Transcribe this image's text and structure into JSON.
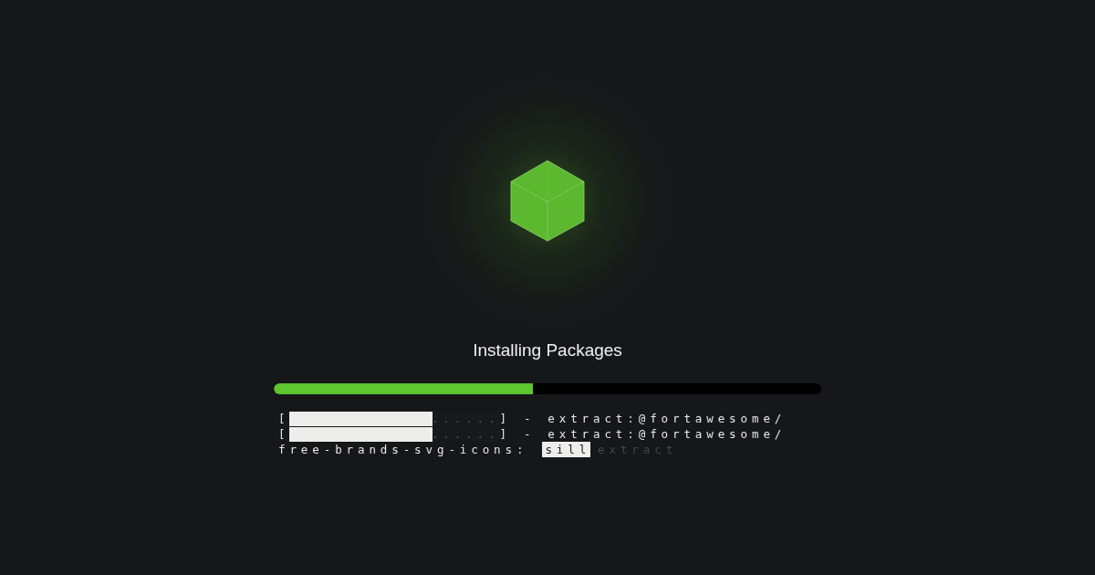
{
  "title": "Installing Packages",
  "progress": {
    "level": 0.473
  },
  "log_lines": [
    {
      "kind": "gauge",
      "open": "[",
      "level": 0.68,
      "dots": "......",
      "close": "]",
      "separator": "-",
      "text": "extract:@fortawesome/"
    },
    {
      "kind": "gauge",
      "open": "[",
      "level": 0.68,
      "dots": "......",
      "close": "]",
      "separator": "-",
      "text": "extract:@fortawesome/"
    },
    {
      "kind": "status",
      "text": "free-brands-svg-icons:",
      "highlight": "sill",
      "dim": "extract"
    }
  ]
}
